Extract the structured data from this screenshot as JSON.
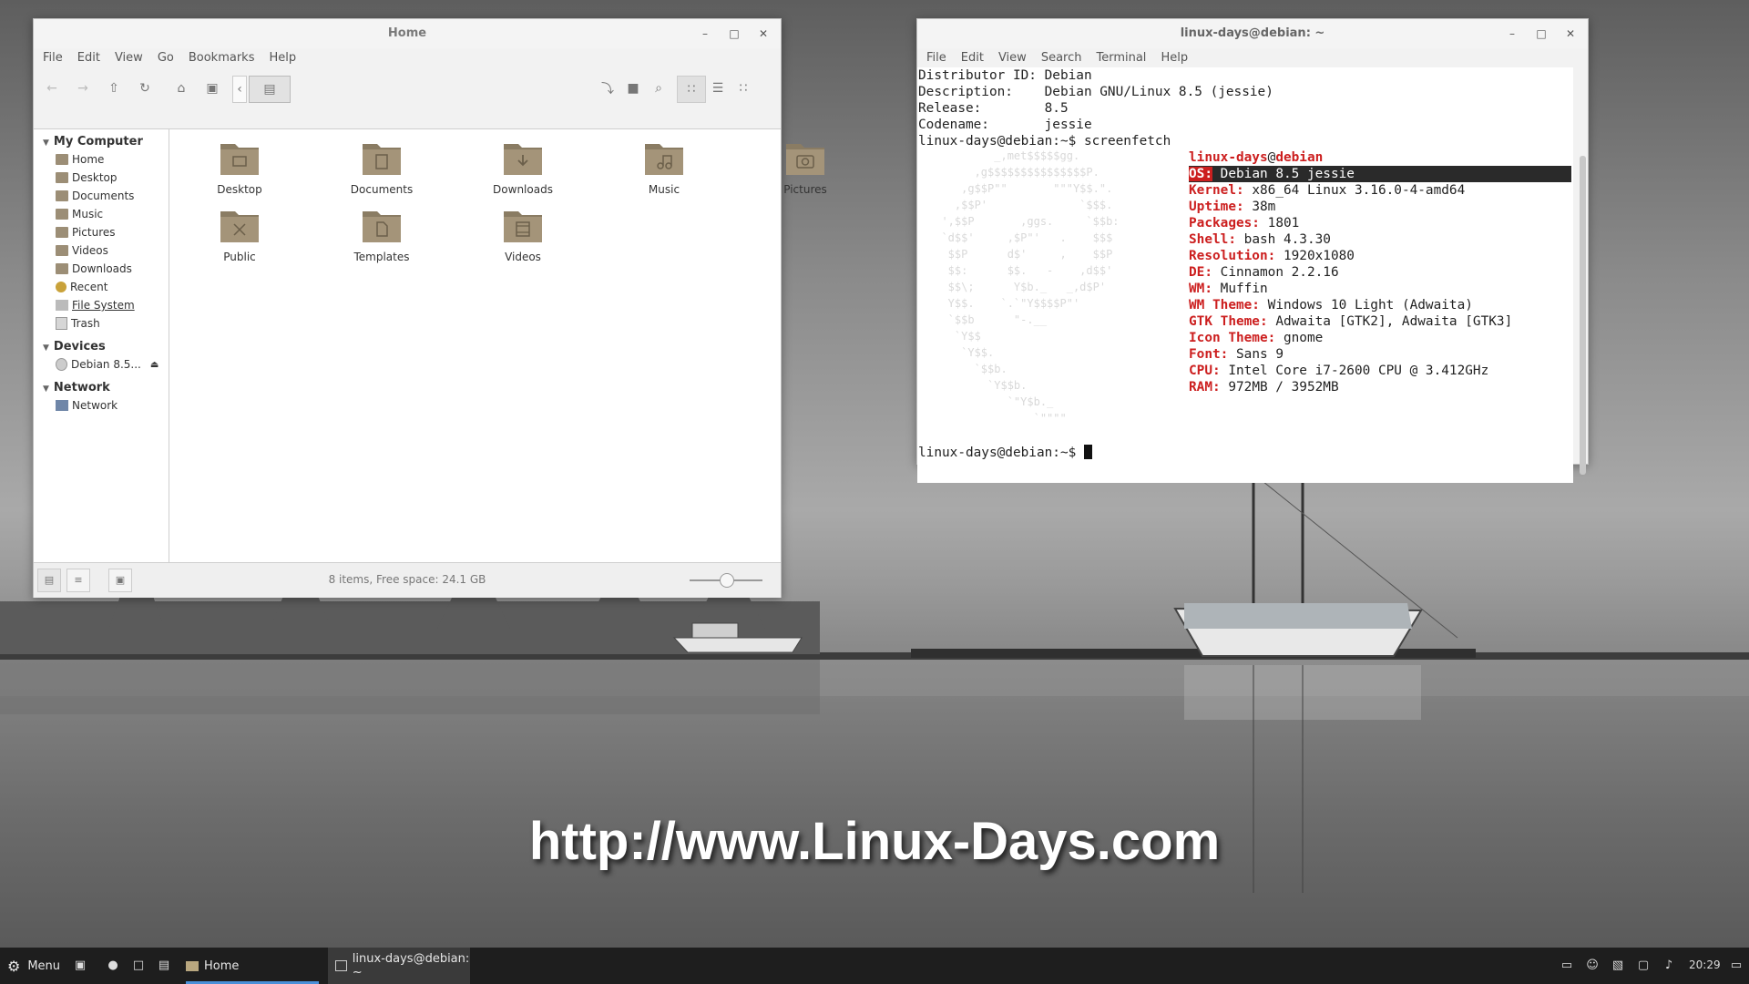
{
  "wallpaper": {
    "watermark": "http://www.Linux-Days.com"
  },
  "file_manager": {
    "title": "Home",
    "menu": [
      "File",
      "Edit",
      "View",
      "Go",
      "Bookmarks",
      "Help"
    ],
    "sidebar": {
      "sections": [
        {
          "label": "My Computer",
          "items": [
            "Home",
            "Desktop",
            "Documents",
            "Music",
            "Pictures",
            "Videos",
            "Downloads",
            "Recent",
            "File System",
            "Trash"
          ]
        },
        {
          "label": "Devices",
          "items": [
            "Debian 8.5..."
          ]
        },
        {
          "label": "Network",
          "items": [
            "Network"
          ]
        }
      ]
    },
    "files": [
      "Desktop",
      "Documents",
      "Downloads",
      "Music",
      "Pictures",
      "Public",
      "Templates",
      "Videos"
    ],
    "status": "8 items, Free space: 24.1 GB",
    "zoom_level": 0.5
  },
  "terminal": {
    "title": "linux-days@debian: ~",
    "menu": [
      "File",
      "Edit",
      "View",
      "Search",
      "Terminal",
      "Help"
    ],
    "lsb": [
      {
        "key": "Distributor ID:",
        "val": "Debian"
      },
      {
        "key": "Description:",
        "val": "Debian GNU/Linux 8.5 (jessie)"
      },
      {
        "key": "Release:",
        "val": "8.5"
      },
      {
        "key": "Codename:",
        "val": "jessie"
      }
    ],
    "prompt": "linux-days@debian:~$",
    "command": "screenfetch",
    "fetch_user": "linux-days",
    "fetch_at": "@",
    "fetch_host": "debian",
    "fetch": [
      {
        "key": "OS:",
        "val": "Debian 8.5 jessie"
      },
      {
        "key": "Kernel:",
        "val": "x86_64 Linux 3.16.0-4-amd64"
      },
      {
        "key": "Uptime:",
        "val": "38m"
      },
      {
        "key": "Packages:",
        "val": "1801"
      },
      {
        "key": "Shell:",
        "val": "bash 4.3.30"
      },
      {
        "key": "Resolution:",
        "val": "1920x1080"
      },
      {
        "key": "DE:",
        "val": "Cinnamon 2.2.16"
      },
      {
        "key": "WM:",
        "val": "Muffin"
      },
      {
        "key": "WM Theme:",
        "val": "Windows 10 Light (Adwaita)"
      },
      {
        "key": "GTK Theme:",
        "val": "Adwaita [GTK2], Adwaita [GTK3]"
      },
      {
        "key": "Icon Theme:",
        "val": "gnome"
      },
      {
        "key": "Font:",
        "val": "Sans 9"
      },
      {
        "key": "CPU:",
        "val": "Intel Core i7-2600 CPU @ 3.412GHz"
      },
      {
        "key": "RAM:",
        "val": "972MB / 3952MB"
      }
    ],
    "ascii_art": "          _,met$$$$$gg.\n       ,g$$$$$$$$$$$$$$$P.\n     ,g$$P\"\"       \"\"\"Y$$.\".\n    ,$$P'              `$$$.\n  ',$$P       ,ggs.     `$$b:\n  `d$$'     ,$P\"'   .    $$$\n   $$P      d$'     ,    $$P\n   $$:      $$.   -    ,d$$'\n   $$\\;      Y$b._   _,d$P'\n   Y$$.    `.`\"Y$$$$P\"'\n   `$$b      \"-.__\n    `Y$$\n     `Y$$.\n       `$$b.\n         `Y$$b.\n            `\"Y$b._\n                `\"\"\"\""
  },
  "taskbar": {
    "menu_label": "Menu",
    "tasks": [
      "Home",
      "linux-days@debian: ~"
    ],
    "clock": "20:29"
  }
}
